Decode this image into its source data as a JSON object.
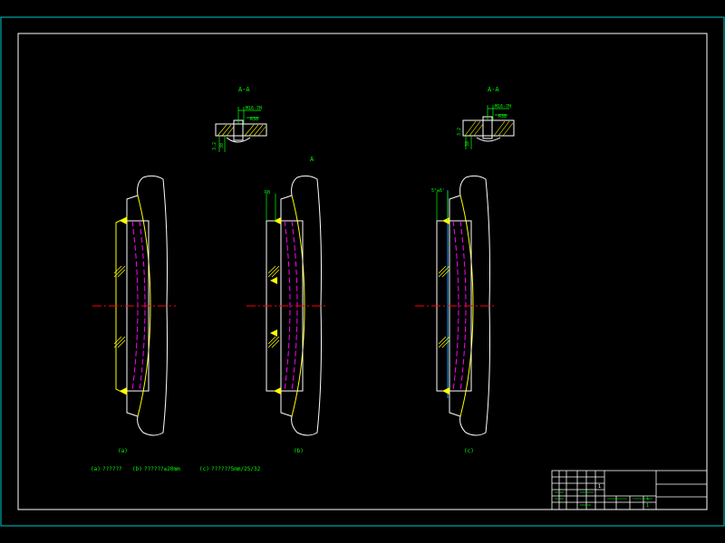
{
  "colors": {
    "background": "#000000",
    "frame": "#00c8c8",
    "inner_frame": "#ffffff",
    "contour": "#ffff00",
    "hidden_line": "#ff00ff",
    "center_line": "#ff0000",
    "dimension": "#00ff00",
    "auxiliary": "#00a0ff",
    "hatch": "#ffff00"
  },
  "section_labels": {
    "left": "A-A",
    "right": "A-A"
  },
  "section_dims": {
    "left_top": "M16-7H",
    "left_sub": "R38",
    "left_side": "3.2",
    "left_side2": "38",
    "right_top": "M16-7H",
    "right_sub": "R38",
    "right_side": "3.2",
    "right_side2": "38"
  },
  "view_marks": {
    "middle_top": "A"
  },
  "view_dims": {
    "b": "R8",
    "c": "5°±6'"
  },
  "view_captions": {
    "a": "(a)",
    "b": "(b)",
    "c": "(c)"
  },
  "notes": {
    "a_label": "(a)",
    "a_text": "??????",
    "b_label": "(b)",
    "b_text": "??????≤20mm",
    "c_label": "(c)",
    "c_text": "??????5mm/25/32"
  },
  "title_block": {
    "small_marks": [
      "1",
      "1",
      "1"
    ]
  }
}
